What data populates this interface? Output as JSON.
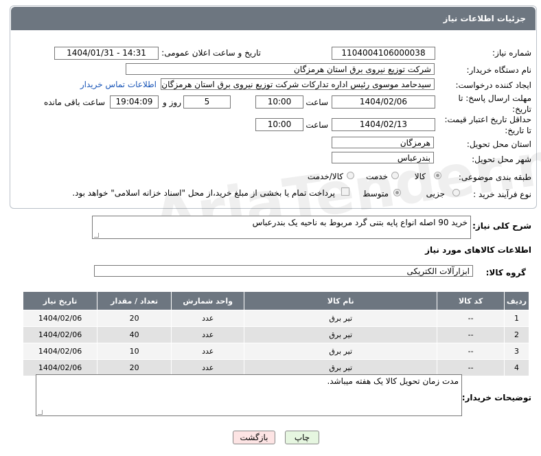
{
  "header": {
    "title": "جزئیات اطلاعات نیاز"
  },
  "fields": {
    "need_number_label": "شماره نیاز:",
    "need_number": "1104004106000038",
    "announce_label": "تاریخ و ساعت اعلان عمومی:",
    "announce_value": "1404/01/31 - 14:31",
    "buyer_org_label": "نام دستگاه خریدار:",
    "buyer_org": "شرکت توزیع نیروی برق استان هرمزگان",
    "creator_label": "ایجاد کننده درخواست:",
    "creator": "سیدحامد موسوی رئیس اداره تدارکات شرکت توزیع نیروی برق استان هرمزگان",
    "contact_link": "اطلاعات تماس خریدار",
    "deadline_label": "مهلت ارسال پاسخ: تا تاریخ:",
    "deadline_date": "1404/02/06",
    "time_label": "ساعت",
    "deadline_time": "10:00",
    "days_value": "5",
    "days_label": "روز و",
    "remaining_time": "19:04:09",
    "remaining_label": "ساعت باقی مانده",
    "validity_label": "حداقل تاریخ اعتبار قیمت: تا تاریخ:",
    "validity_date": "1404/02/13",
    "validity_time": "10:00",
    "province_label": "استان محل تحویل:",
    "province": "هرمزگان",
    "city_label": "شهر محل تحویل:",
    "city": "بندرعباس",
    "category_label": "طبقه بندی موضوعی:",
    "category_options": [
      "کالا",
      "خدمت",
      "کالا/خدمت"
    ],
    "purchase_type_label": "نوع فرآیند خرید :",
    "purchase_options": [
      "جزیی",
      "متوسط"
    ],
    "payment_note": "پرداخت تمام یا بخشی از مبلغ خرید،از محل \"اسناد خزانه اسلامی\" خواهد بود."
  },
  "description": {
    "label": "شرح کلی نیاز:",
    "text": "خرید 90 اصله انواع پایه بتنی گرد مربوط به ناحیه یک بندرعباس"
  },
  "goods_section": {
    "title": "اطلاعات کالاهای مورد نیاز",
    "group_label": "گروه کالا:",
    "group_value": "ابزارآلات الکتریکی"
  },
  "table": {
    "headers": [
      "ردیف",
      "کد کالا",
      "نام کالا",
      "واحد شمارش",
      "تعداد / مقدار",
      "تاریخ نیاز"
    ],
    "rows": [
      [
        "1",
        "--",
        "تیر برق",
        "عدد",
        "20",
        "1404/02/06"
      ],
      [
        "2",
        "--",
        "تیر برق",
        "عدد",
        "40",
        "1404/02/06"
      ],
      [
        "3",
        "--",
        "تیر برق",
        "عدد",
        "10",
        "1404/02/06"
      ],
      [
        "4",
        "--",
        "تیر برق",
        "عدد",
        "20",
        "1404/02/06"
      ]
    ]
  },
  "buyer_notes": {
    "label": "توضیحات خریدار:",
    "text": "مدت زمان تحویل کالا یک هفته میباشد."
  },
  "buttons": {
    "print": "چاپ",
    "back": "بازگشت"
  },
  "watermark": "AriaTender.net"
}
